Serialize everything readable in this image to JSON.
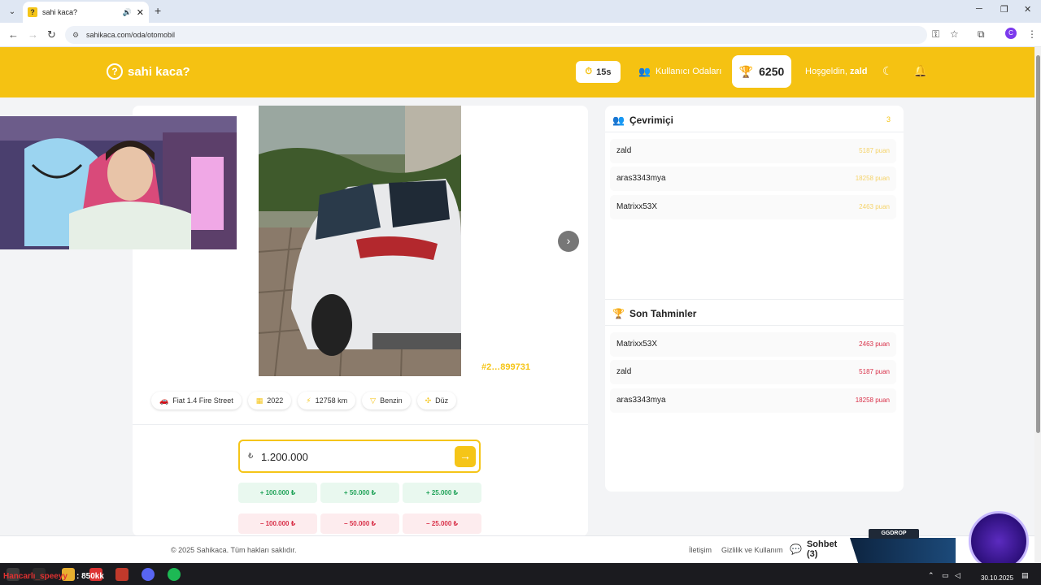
{
  "browser": {
    "tab_title": "sahi kaca?",
    "url": "sahikaca.com/oda/otomobil",
    "profile_initial": "C"
  },
  "header": {
    "logo": "sahi kaca?",
    "timer": "15s",
    "rooms_label": "Kullanıcı Odaları",
    "score": "6250",
    "welcome_prefix": "Hoşgeldin,",
    "username": "zald"
  },
  "listing": {
    "id": "#2…899731",
    "chips": [
      {
        "icon": "car-icon",
        "label": "Fiat 1.4 Fire Street"
      },
      {
        "icon": "calendar-icon",
        "label": "2022"
      },
      {
        "icon": "gauge-icon",
        "label": "12758 km"
      },
      {
        "icon": "fuel-icon",
        "label": "Benzin"
      },
      {
        "icon": "gear-icon",
        "label": "Düz"
      }
    ]
  },
  "guess": {
    "currency": "₺",
    "value": "1.200.000",
    "plus": [
      "+ 100.000 ₺",
      "+ 50.000 ₺",
      "+ 25.000 ₺"
    ],
    "minus": [
      "− 100.000 ₺",
      "− 50.000 ₺",
      "− 25.000 ₺"
    ]
  },
  "online": {
    "title": "Çevrimiçi",
    "count": "3",
    "users": [
      {
        "name": "zald",
        "points": "5187 puan"
      },
      {
        "name": "aras3343mya",
        "points": "18258 puan"
      },
      {
        "name": "Matrixx53X",
        "points": "2463 puan"
      }
    ]
  },
  "recent": {
    "title": "Son Tahminler",
    "items": [
      {
        "name": "Matrixx53X",
        "points": "2463 puan"
      },
      {
        "name": "zald",
        "points": "5187 puan"
      },
      {
        "name": "aras3343mya",
        "points": "18258 puan"
      }
    ]
  },
  "footer": {
    "copyright": "© 2025 Sahikaca. Tüm hakları saklıdır.",
    "contact": "İletişim",
    "privacy": "Gizlilik ve Kullanım",
    "chat": "Sohbet (3)"
  },
  "overlay": {
    "brand": "GGDROP",
    "ticker_name": "Hancarlı_speeyy",
    "ticker_amount": ": 850kk"
  },
  "taskbar": {
    "date": "30.10.2025"
  }
}
